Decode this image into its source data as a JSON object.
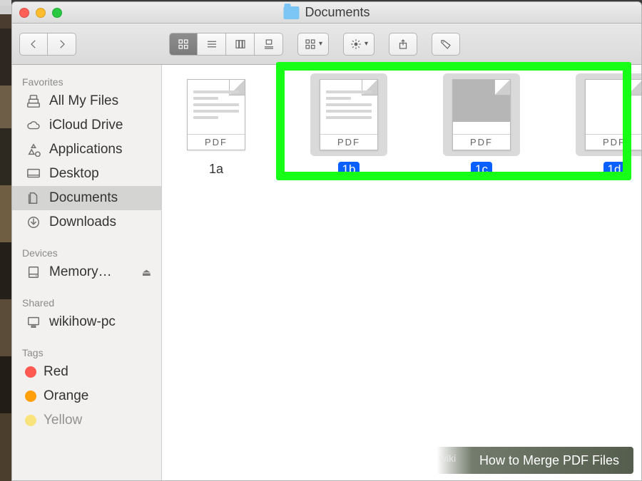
{
  "window": {
    "title": "Documents"
  },
  "sidebar": {
    "favorites_label": "Favorites",
    "favorites": [
      {
        "label": "All My Files",
        "icon": "all-files"
      },
      {
        "label": "iCloud Drive",
        "icon": "cloud"
      },
      {
        "label": "Applications",
        "icon": "apps"
      },
      {
        "label": "Desktop",
        "icon": "desktop"
      },
      {
        "label": "Documents",
        "icon": "documents",
        "active": true
      },
      {
        "label": "Downloads",
        "icon": "downloads"
      }
    ],
    "devices_label": "Devices",
    "devices": [
      {
        "label": "Memory…",
        "icon": "disk",
        "ejectable": true
      }
    ],
    "shared_label": "Shared",
    "shared": [
      {
        "label": "wikihow-pc",
        "icon": "pc"
      }
    ],
    "tags_label": "Tags",
    "tags": [
      {
        "label": "Red",
        "color": "#ff5a52"
      },
      {
        "label": "Orange",
        "color": "#ff9f0a"
      },
      {
        "label": "Yellow",
        "color": "#ffd60a"
      }
    ]
  },
  "files": [
    {
      "name": "1a",
      "type": "pdf",
      "selected": false,
      "preview": "text"
    },
    {
      "name": "1b",
      "type": "pdf",
      "selected": true,
      "preview": "text"
    },
    {
      "name": "1c",
      "type": "pdf",
      "selected": true,
      "preview": "band"
    },
    {
      "name": "1d",
      "type": "pdf",
      "selected": true,
      "preview": "blank"
    }
  ],
  "pdf_badge": "PDF",
  "highlighted_files": [
    "1b",
    "1c",
    "1d"
  ],
  "caption": "How to Merge PDF Files",
  "caption_prefix": "wiki"
}
